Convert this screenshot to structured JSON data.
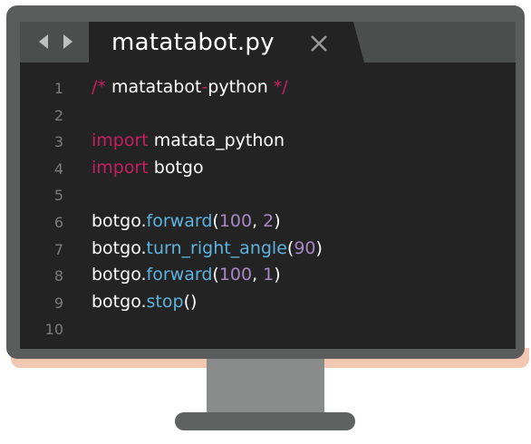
{
  "window": {
    "tab_title": "matatabot.py",
    "nav_back_icon": "chevron-left-icon",
    "nav_forward_icon": "chevron-right-icon",
    "close_icon": "close-icon"
  },
  "editor": {
    "lines": [
      {
        "number": "1",
        "tokens": [
          {
            "type": "com",
            "text": "/*"
          },
          {
            "type": "plain",
            "text": " matatabot"
          },
          {
            "type": "com",
            "text": "-"
          },
          {
            "type": "plain",
            "text": "python "
          },
          {
            "type": "com",
            "text": "*/"
          }
        ]
      },
      {
        "number": "2",
        "tokens": []
      },
      {
        "number": "3",
        "tokens": [
          {
            "type": "kw",
            "text": "import"
          },
          {
            "type": "plain",
            "text": " matata_python"
          }
        ]
      },
      {
        "number": "4",
        "tokens": [
          {
            "type": "kw",
            "text": "import"
          },
          {
            "type": "plain",
            "text": " botgo"
          }
        ]
      },
      {
        "number": "5",
        "tokens": []
      },
      {
        "number": "6",
        "tokens": [
          {
            "type": "plain",
            "text": "botgo."
          },
          {
            "type": "fn",
            "text": "forward"
          },
          {
            "type": "plain",
            "text": "("
          },
          {
            "type": "num",
            "text": "100"
          },
          {
            "type": "plain",
            "text": ", "
          },
          {
            "type": "num",
            "text": "2"
          },
          {
            "type": "plain",
            "text": ")"
          }
        ]
      },
      {
        "number": "7",
        "tokens": [
          {
            "type": "plain",
            "text": "botgo."
          },
          {
            "type": "fn",
            "text": "turn_right_angle"
          },
          {
            "type": "plain",
            "text": "("
          },
          {
            "type": "num",
            "text": "90"
          },
          {
            "type": "plain",
            "text": ")"
          }
        ]
      },
      {
        "number": "8",
        "tokens": [
          {
            "type": "plain",
            "text": "botgo."
          },
          {
            "type": "fn",
            "text": "forward"
          },
          {
            "type": "plain",
            "text": "("
          },
          {
            "type": "num",
            "text": "100"
          },
          {
            "type": "plain",
            "text": ", "
          },
          {
            "type": "num",
            "text": "1"
          },
          {
            "type": "plain",
            "text": ")"
          }
        ]
      },
      {
        "number": "9",
        "tokens": [
          {
            "type": "plain",
            "text": "botgo."
          },
          {
            "type": "fn",
            "text": "stop"
          },
          {
            "type": "plain",
            "text": "()"
          }
        ]
      },
      {
        "number": "10",
        "tokens": []
      }
    ]
  },
  "colors": {
    "keyword": "#c4205f",
    "function": "#5fb3e0",
    "number": "#a987c7",
    "text": "#ffffff",
    "line_number": "#7c7c7c",
    "editor_bg": "#222322",
    "bezel": "#5b5c5c"
  }
}
